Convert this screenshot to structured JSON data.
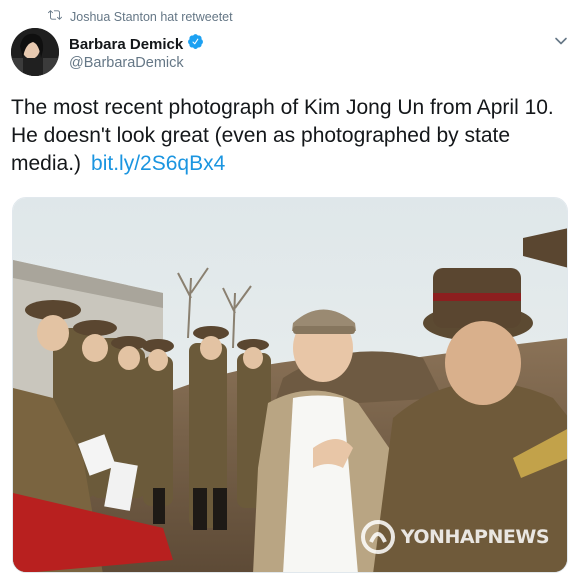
{
  "retweet": {
    "text": "Joshua Stanton hat retweetet",
    "icon": "retweet-icon"
  },
  "author": {
    "display_name": "Barbara Demick",
    "handle": "@BarbaraDemick",
    "verified": true,
    "verified_color": "#1da1f2"
  },
  "tweet": {
    "text": "The most recent photograph of Kim Jong Un from April 10. He doesn't look great (even as photographed by state media.)",
    "link": "bit.ly/2S6qBx4",
    "link_color": "#1b95e0"
  },
  "photo": {
    "watermark": "YONHAPNEWS"
  }
}
